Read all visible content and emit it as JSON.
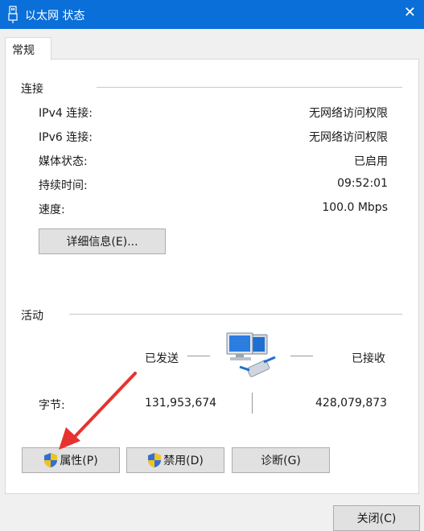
{
  "window": {
    "title": "以太网 状态",
    "close_icon": "close-icon",
    "app_icon": "network-adapter-icon",
    "accent": "#0a6fd8"
  },
  "tabs": [
    {
      "label": "常规"
    }
  ],
  "connection": {
    "section_title": "连接",
    "rows": [
      {
        "label": "IPv4 连接:",
        "value": "无网络访问权限"
      },
      {
        "label": "IPv6 连接:",
        "value": "无网络访问权限"
      },
      {
        "label": "媒体状态:",
        "value": "已启用"
      },
      {
        "label": "持续时间:",
        "value": "09:52:01"
      },
      {
        "label": "速度:",
        "value": "100.0 Mbps"
      }
    ],
    "details_button": "详细信息(E)..."
  },
  "activity": {
    "section_title": "活动",
    "sent_label": "已发送",
    "received_label": "已接收",
    "bytes_label": "字节:",
    "bytes_sent": "131,953,674",
    "bytes_received": "428,079,873",
    "icon": "network-computers-icon"
  },
  "buttons": {
    "properties": "属性(P)",
    "disable": "禁用(D)",
    "diagnose": "诊断(G)",
    "close": "关闭(C)"
  },
  "annotation": {
    "arrow_color": "#e8322f"
  }
}
